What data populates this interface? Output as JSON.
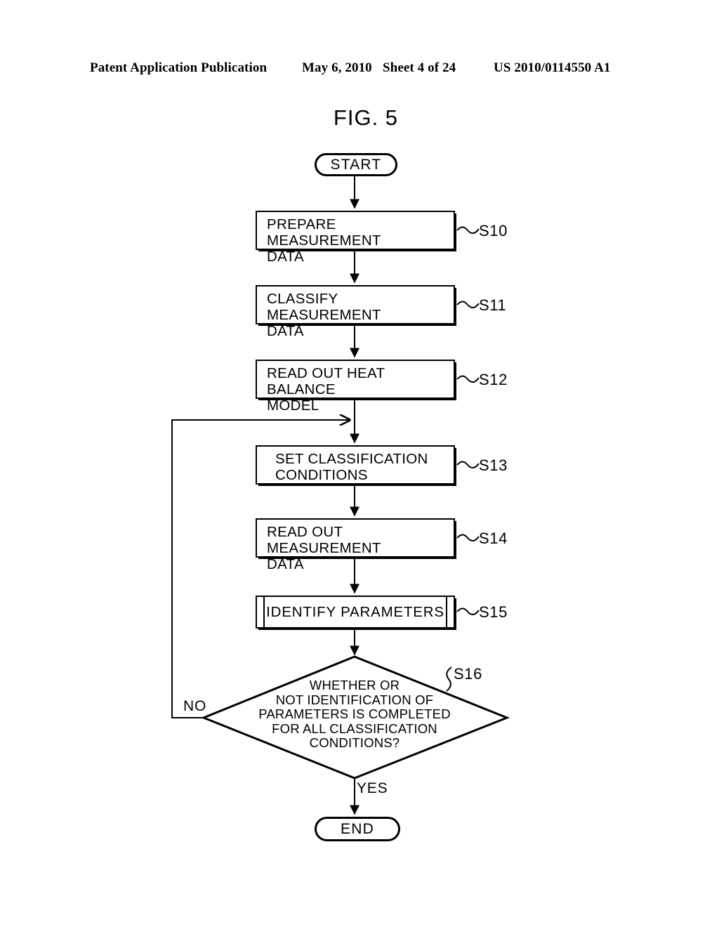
{
  "header": {
    "publication": "Patent Application Publication",
    "date": "May 6, 2010",
    "sheet": "Sheet 4 of 24",
    "patent_number": "US 2010/0114550 A1"
  },
  "figure": {
    "title": "FIG. 5",
    "type": "flowchart"
  },
  "flow": {
    "start_label": "START",
    "end_label": "END",
    "steps": [
      {
        "id": "S10",
        "ref": "S10",
        "line1": "PREPARE  MEASUREMENT",
        "line2": "DATA",
        "shape": "process"
      },
      {
        "id": "S11",
        "ref": "S11",
        "line1": "CLASSIFY  MEASUREMENT",
        "line2": "DATA",
        "shape": "process"
      },
      {
        "id": "S12",
        "ref": "S12",
        "line1": "READ  OUT  HEAT  BALANCE",
        "line2": "MODEL",
        "shape": "process"
      },
      {
        "id": "S13",
        "ref": "S13",
        "line1": "SET  CLASSIFICATION",
        "line2": "CONDITIONS",
        "shape": "process"
      },
      {
        "id": "S14",
        "ref": "S14",
        "line1": "READ  OUT  MEASUREMENT",
        "line2": "DATA",
        "shape": "process"
      },
      {
        "id": "S15",
        "ref": "S15",
        "line1": "IDENTIFY  PARAMETERS",
        "line2": "",
        "shape": "predefined-process"
      }
    ],
    "decision": {
      "ref": "S16",
      "line1": "WHETHER  OR",
      "line2": "NOT IDENTIFICATION  OF",
      "line3": "PARAMETERS  IS  COMPLETED",
      "line4": "FOR  ALL  CLASSIFICATION",
      "line5": "CONDITIONS?",
      "no_label": "NO",
      "yes_label": "YES"
    }
  },
  "colors": {
    "ink": "#000000",
    "paper": "#ffffff"
  }
}
